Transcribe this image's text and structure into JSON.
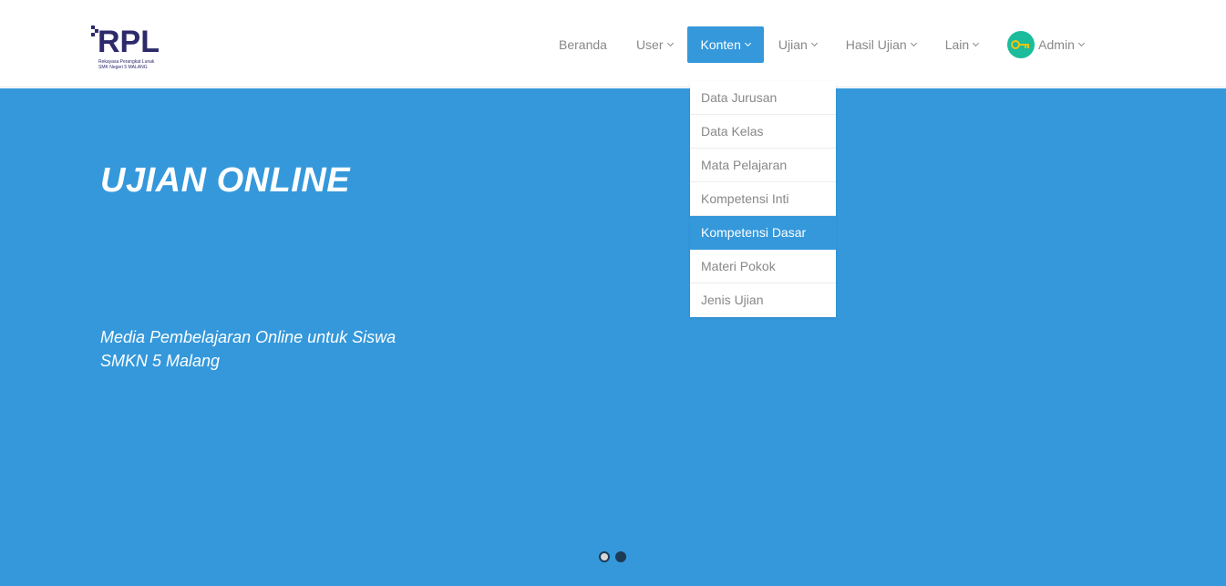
{
  "logo": {
    "text": "RPL",
    "sub1": "Rekayasa Perangkat Lunak",
    "sub2": "SMK Negeri 5 MALANG"
  },
  "nav": {
    "beranda": "Beranda",
    "user": "User",
    "konten": "Konten",
    "ujian": "Ujian",
    "hasil_ujian": "Hasil Ujian",
    "lain": "Lain",
    "admin": "Admin"
  },
  "dropdown": {
    "items": [
      {
        "label": "Data Jurusan"
      },
      {
        "label": "Data Kelas"
      },
      {
        "label": "Mata Pelajaran"
      },
      {
        "label": "Kompetensi Inti"
      },
      {
        "label": "Kompetensi Dasar"
      },
      {
        "label": "Materi Pokok"
      },
      {
        "label": "Jenis Ujian"
      }
    ],
    "active_index": 4
  },
  "hero": {
    "title": "UJIAN ONLINE",
    "subtitle_line1": "Media Pembelajaran Online untuk Siswa",
    "subtitle_line2": "SMKN 5 Malang"
  },
  "carousel": {
    "slides": 2,
    "active": 1
  },
  "colors": {
    "primary": "#3498db",
    "logo": "#2c2a6b",
    "avatar": "#1abc9c",
    "nav_text": "#888888"
  },
  "icons": {
    "avatar": "key-icon",
    "dropdown": "chevron-down-icon"
  }
}
